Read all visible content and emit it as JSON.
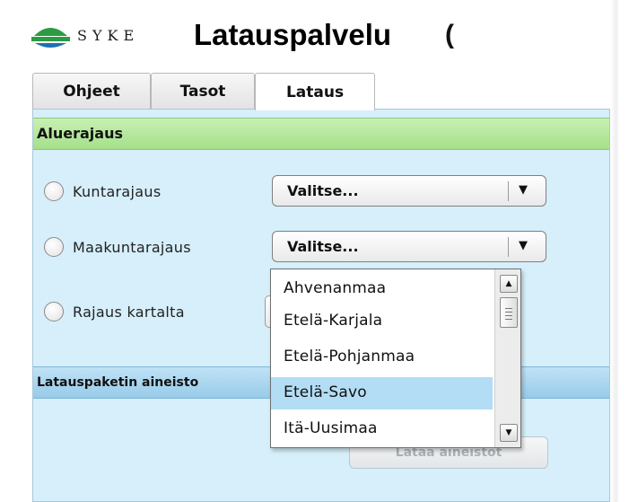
{
  "header": {
    "brand": "SYKE",
    "title": "Latauspalvelu",
    "title_trailing": "("
  },
  "tabs": [
    {
      "label": "Ohjeet",
      "active": false
    },
    {
      "label": "Tasot",
      "active": false
    },
    {
      "label": "Lataus",
      "active": true
    }
  ],
  "sections": {
    "aluerajaus": "Aluerajaus",
    "latauspaketti": "Latauspaketin aineisto"
  },
  "options": {
    "kuntarajaus": {
      "label": "Kuntarajaus",
      "selected": false,
      "select_value": "Valitse..."
    },
    "maakuntarajaus": {
      "label": "Maakuntarajaus",
      "selected": false,
      "select_value": "Valitse..."
    },
    "rajaus_kartalta": {
      "label": "Rajaus kartalta",
      "selected": false
    }
  },
  "dropdown": {
    "items": [
      "Ahvenanmaa",
      "Etelä-Karjala",
      "Etelä-Pohjanmaa",
      "Etelä-Savo",
      "Itä-Uusimaa"
    ],
    "highlighted": "Etelä-Savo"
  },
  "download": {
    "label": "Lataa aineistot",
    "enabled": false
  },
  "colors": {
    "panel_bg": "#d6effa",
    "section_green": "#b4e8a0",
    "section_blue": "#a8d4ee",
    "highlight": "#b3ddf4",
    "logo_green": "#2d9a44",
    "logo_blue": "#1f6fb5"
  },
  "icons": {
    "select_arrow": "chevron-down-icon",
    "scroll_up": "scroll-up-icon",
    "scroll_down": "scroll-down-icon"
  }
}
